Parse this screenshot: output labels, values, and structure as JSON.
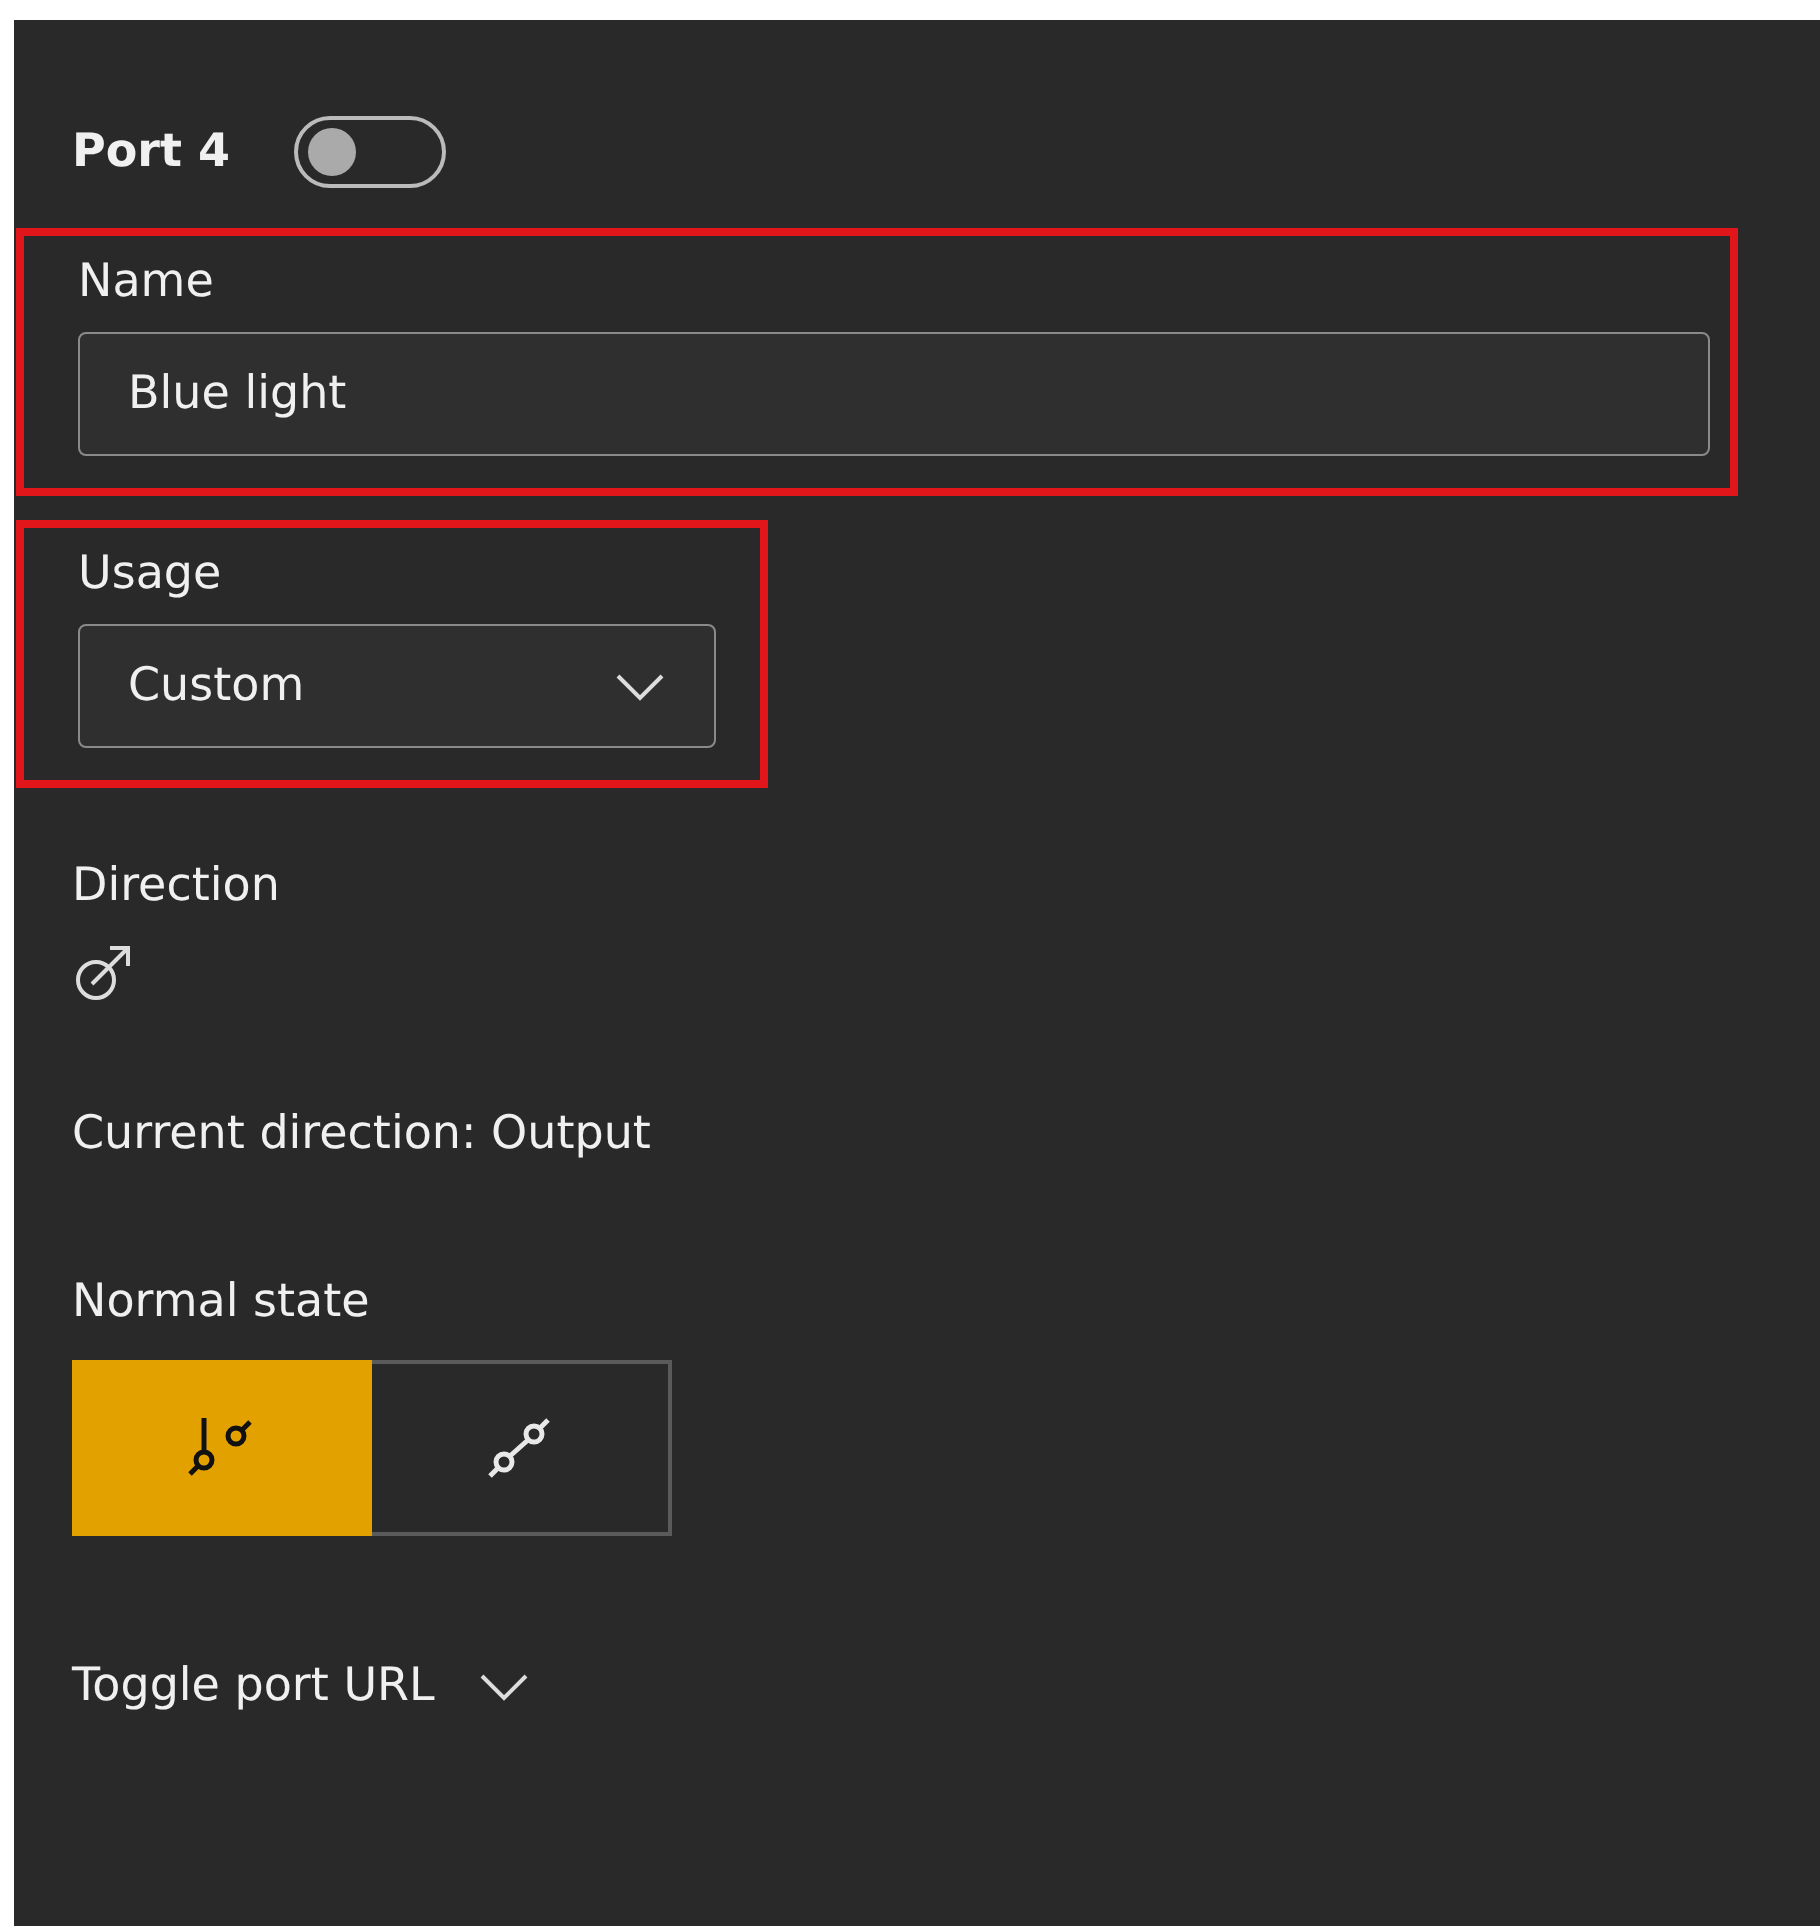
{
  "port": {
    "label": "Port 4",
    "on": false
  },
  "name_field": {
    "label": "Name",
    "value": "Blue light",
    "highlighted": true
  },
  "usage_field": {
    "label": "Usage",
    "value": "Custom",
    "highlighted": true
  },
  "direction": {
    "label": "Direction",
    "current": "Current direction: Output"
  },
  "normal_state": {
    "label": "Normal state",
    "options": [
      {
        "kind": "open",
        "selected": true
      },
      {
        "kind": "closed",
        "selected": false
      }
    ]
  },
  "toggle_url": {
    "label": "Toggle port URL",
    "expanded": false
  }
}
